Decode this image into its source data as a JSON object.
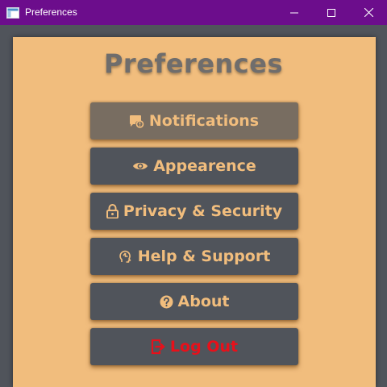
{
  "window": {
    "title": "Preferences",
    "controls": {
      "minimize": "minimize",
      "maximize": "maximize",
      "close": "close"
    }
  },
  "page": {
    "heading": "Preferences"
  },
  "menu": {
    "items": [
      {
        "label": "Notifications",
        "icon": "notification-icon",
        "state": "hover"
      },
      {
        "label": "Appearence",
        "icon": "eye-icon"
      },
      {
        "label": "Privacy & Security",
        "icon": "lock-icon"
      },
      {
        "label": "Help & Support",
        "icon": "support-icon"
      },
      {
        "label": "About",
        "icon": "question-circle-icon"
      },
      {
        "label": "Log Out",
        "icon": "logout-icon",
        "color": "#e8101a"
      }
    ]
  },
  "colors": {
    "titlebar": "#6c0d8c",
    "panel": "#f1bd7d",
    "button": "#50545b",
    "button_active": "#786d61",
    "accent_text": "#f1bd7d",
    "danger": "#e8101a"
  }
}
